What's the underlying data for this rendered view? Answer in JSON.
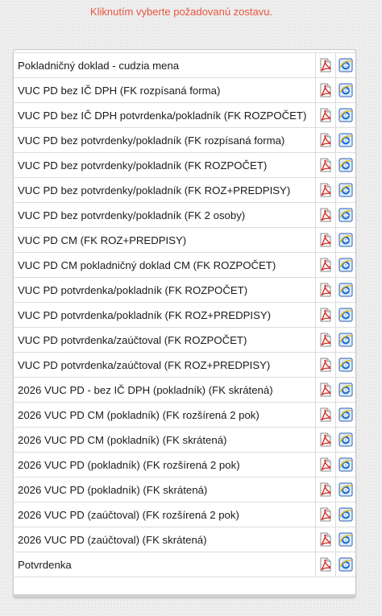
{
  "instruction": "Kliknutím vyberte požadovanú zostavu.",
  "icons": {
    "pdf": "pdf-icon",
    "web": "internet-explorer-icon"
  },
  "colors": {
    "instruction": "#e8553e",
    "pdf": "#d2231c",
    "ie": "#1c6fd2"
  },
  "reports": [
    "Pokladničný doklad - cudzia mena",
    "VUC PD bez IČ DPH (FK rozpísaná forma)",
    "VUC PD bez IČ DPH potvrdenka/pokladník (FK ROZPOČET)",
    "VUC PD bez potvrdenky/pokladník (FK rozpísaná forma)",
    "VUC PD bez potvrdenky/pokladník (FK ROZPOČET)",
    "VUC PD bez potvrdenky/pokladník (FK ROZ+PREDPISY)",
    "VUC PD bez potvrdenky/pokladník (FK 2 osoby)",
    "VUC PD CM (FK ROZ+PREDPISY)",
    "VUC PD CM pokladničný doklad CM (FK ROZPOČET)",
    "VUC PD potvrdenka/pokladník (FK ROZPOČET)",
    "VUC PD potvrdenka/pokladník (FK ROZ+PREDPISY)",
    "VUC PD potvrdenka/zaúčtoval (FK ROZPOČET)",
    "VUC PD potvrdenka/zaúčtoval (FK ROZ+PREDPISY)",
    "2026 VUC PD - bez IČ DPH (pokladník) (FK skrátená)",
    "2026 VUC PD CM (pokladník) (FK rozšírená 2 pok)",
    "2026 VUC PD CM (pokladník) (FK skrátená)",
    "2026 VUC PD (pokladník) (FK rozšírená 2 pok)",
    "2026 VUC PD (pokladník) (FK skrátená)",
    "2026 VUC PD (zaúčtoval) (FK rozšírená 2 pok)",
    "2026 VUC PD (zaúčtoval) (FK skrátená)",
    "Potvrdenka"
  ]
}
